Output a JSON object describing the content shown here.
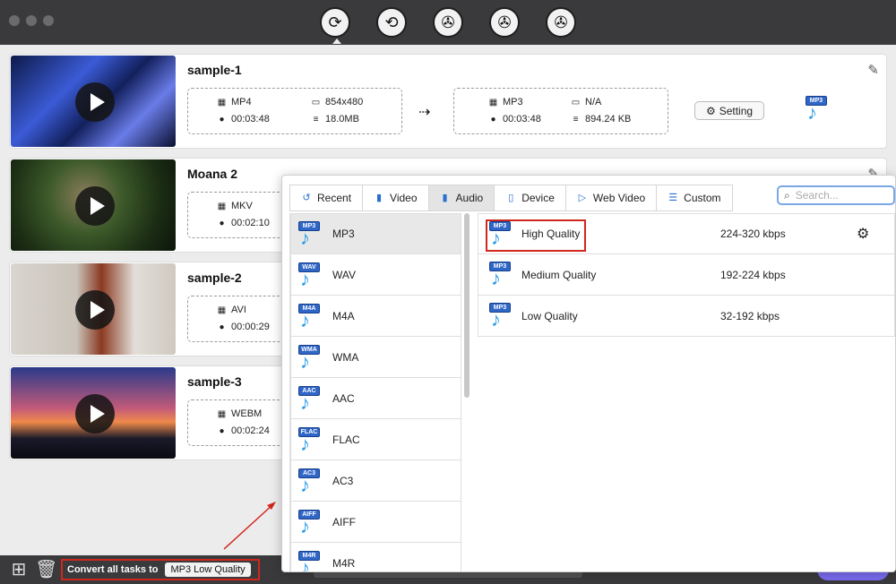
{
  "toolbar": {
    "tools": [
      "convert-icon",
      "compress-icon",
      "video-editor-icon",
      "merge-icon",
      "toolbox-icon"
    ]
  },
  "tasks": [
    {
      "title": "sample-1",
      "src_format": "MP4",
      "src_res": "854x480",
      "src_duration": "00:03:48",
      "src_size": "18.0MB",
      "dst_format": "MP3",
      "dst_res": "N/A",
      "dst_duration": "00:03:48",
      "dst_size": "894.24 KB",
      "setting_label": "Setting",
      "out_badge": "MP3"
    },
    {
      "title": "Moana 2",
      "src_format": "MKV",
      "src_duration": "00:02:10"
    },
    {
      "title": "sample-2",
      "src_format": "AVI",
      "src_duration": "00:00:29"
    },
    {
      "title": "sample-3",
      "src_format": "WEBM",
      "src_duration": "00:02:24"
    }
  ],
  "popup": {
    "tabs": [
      {
        "label": "Recent",
        "icon": "recent-icon"
      },
      {
        "label": "Video",
        "icon": "video-icon"
      },
      {
        "label": "Audio",
        "icon": "audio-icon"
      },
      {
        "label": "Device",
        "icon": "device-icon"
      },
      {
        "label": "Web Video",
        "icon": "web-video-icon"
      },
      {
        "label": "Custom",
        "icon": "custom-icon"
      }
    ],
    "active_tab": "Audio",
    "search_placeholder": "Search...",
    "formats": [
      {
        "label": "MP3",
        "badge": "MP3"
      },
      {
        "label": "WAV",
        "badge": "WAV"
      },
      {
        "label": "M4A",
        "badge": "M4A"
      },
      {
        "label": "WMA",
        "badge": "WMA"
      },
      {
        "label": "AAC",
        "badge": "AAC"
      },
      {
        "label": "FLAC",
        "badge": "FLAC"
      },
      {
        "label": "AC3",
        "badge": "AC3"
      },
      {
        "label": "AIFF",
        "badge": "AIFF"
      },
      {
        "label": "M4R",
        "badge": "M4R"
      }
    ],
    "qualities": [
      {
        "name": "High Quality",
        "rate": "224-320 kbps",
        "badge": "MP3"
      },
      {
        "name": "Medium Quality",
        "rate": "192-224 kbps",
        "badge": "MP3"
      },
      {
        "name": "Low Quality",
        "rate": "32-192 kbps",
        "badge": "MP3"
      }
    ]
  },
  "bottom": {
    "convert_all_label": "Convert all tasks to",
    "convert_all_value": "MP3 Low Quality"
  }
}
